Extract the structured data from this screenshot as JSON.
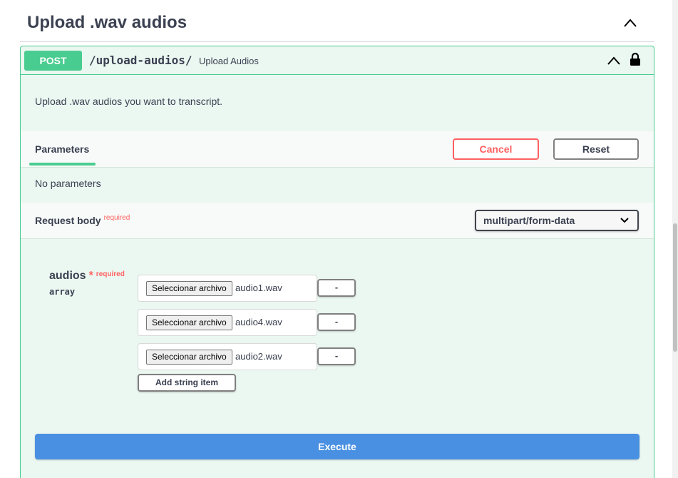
{
  "section": {
    "title": "Upload .wav audios"
  },
  "operation": {
    "method": "POST",
    "path": "/upload-audios/",
    "summary": "Upload Audios",
    "description": "Upload .wav audios you want to transcript."
  },
  "parameters": {
    "tab_label": "Parameters",
    "cancel_label": "Cancel",
    "reset_label": "Reset",
    "empty_text": "No parameters"
  },
  "request_body": {
    "label": "Request body",
    "required_label": "required",
    "content_type": "multipart/form-data"
  },
  "field": {
    "name": "audios",
    "star": "*",
    "required_label": "required",
    "type": "array",
    "items": [
      {
        "button_label": "Seleccionar archivo",
        "file_name": "audio1.wav",
        "remove_label": "-"
      },
      {
        "button_label": "Seleccionar archivo",
        "file_name": "audio4.wav",
        "remove_label": "-"
      },
      {
        "button_label": "Seleccionar archivo",
        "file_name": "audio2.wav",
        "remove_label": "-"
      }
    ],
    "add_label": "Add string item"
  },
  "execute_label": "Execute",
  "colors": {
    "post_green": "#49cc90",
    "cancel_red": "#ff6060",
    "execute_blue": "#4990e2"
  }
}
